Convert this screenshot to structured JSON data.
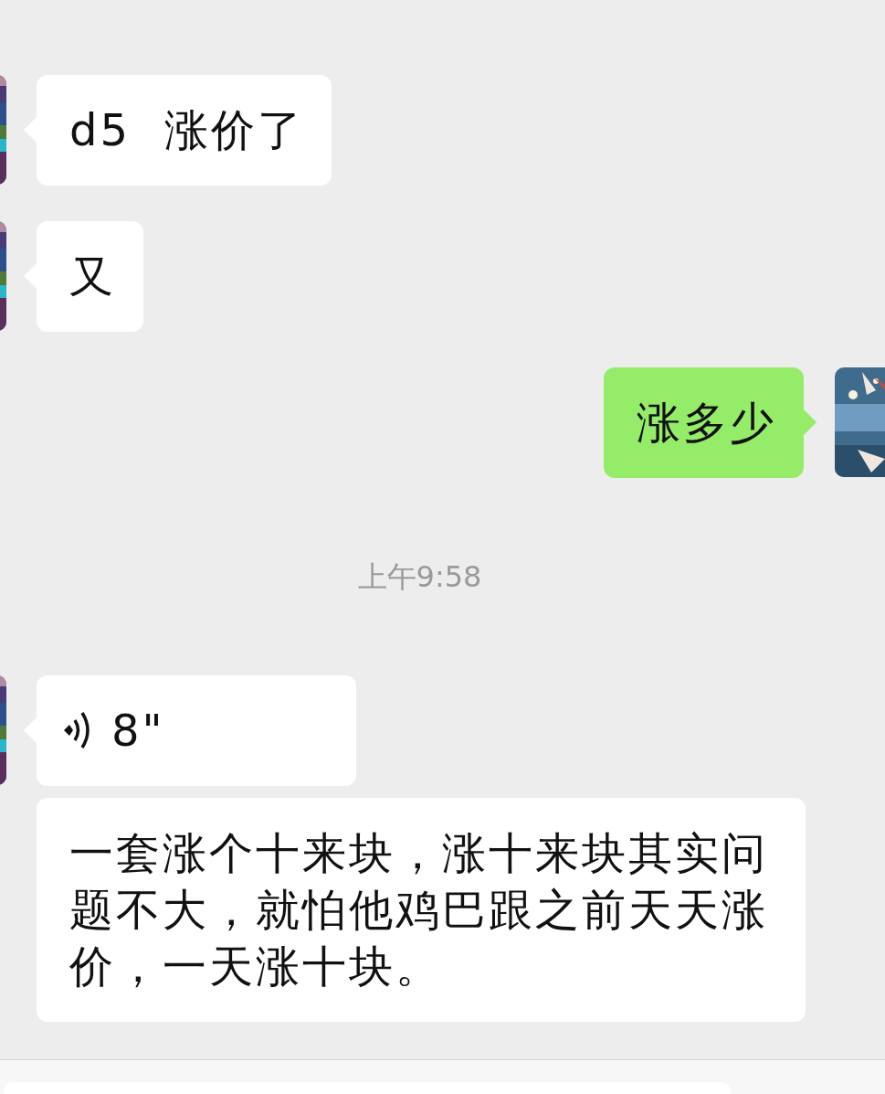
{
  "messages": [
    {
      "kind": "text",
      "sent": false,
      "avatar": true,
      "text": "d5  涨价了"
    },
    {
      "kind": "text",
      "sent": false,
      "avatar": true,
      "text": "又"
    },
    {
      "kind": "text",
      "sent": true,
      "avatar": true,
      "text": "涨多少"
    },
    {
      "kind": "time",
      "text": "上午9:58"
    },
    {
      "kind": "voice",
      "sent": false,
      "avatar": true,
      "duration": "8\""
    },
    {
      "kind": "text",
      "sent": false,
      "avatar": false,
      "text": "一套涨个十来块，涨十来块其实问题不大，就怕他鸡巴跟之前天天涨价，一天涨十块。"
    }
  ]
}
